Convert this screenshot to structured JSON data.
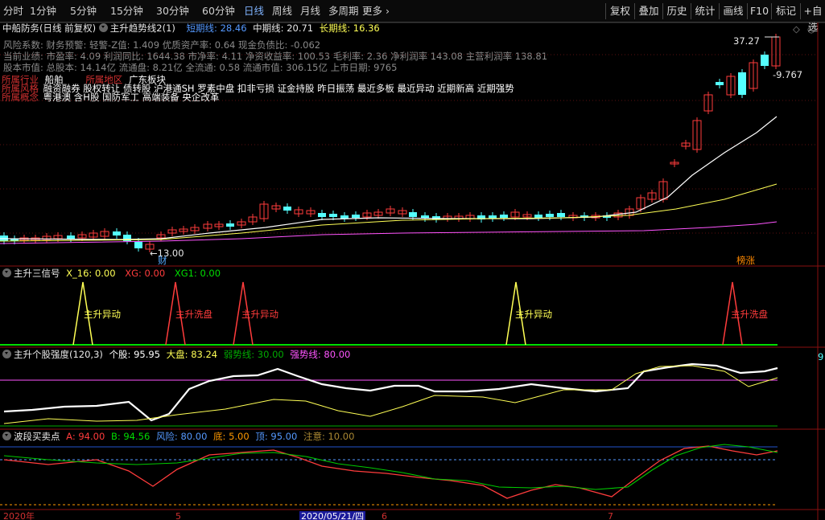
{
  "toolbar": {
    "periods": [
      "分时",
      "1分钟",
      "5分钟",
      "15分钟",
      "30分钟",
      "60分钟",
      "日线",
      "周线",
      "月线",
      "多周期",
      "更多"
    ],
    "active_period": "日线",
    "right_buttons": [
      "复权",
      "叠加",
      "历史",
      "统计",
      "画线",
      "F10",
      "标记",
      "+自选"
    ]
  },
  "main_panel": {
    "stock": "中船防务(日线 前复权)",
    "indicator": "主升趋势线2(1)",
    "short_line": "短期线: 28.46",
    "mid_line": "中期线: 20.71",
    "long_line": "长期线: 16.36",
    "info_lines": [
      "风险系数: 财务预警: 轻警-Z值: 1.409 优质资产率: 0.64 现金负债比: -0.062",
      "当前业绩: 市盈率: 4.09 利润同比: 1644.38 市净率: 4.11 净资收益率: 100.53 毛利率: 2.36 净利润率 143.08 主营利润率 138.81",
      "股本市值: 总股本: 14.14亿 流通盘: 8.21亿 全流通: 0.58 流通市值: 306.15亿 上市日期: 9765"
    ],
    "industry_label": "所属行业",
    "industry_value": "船舶",
    "region_label": "所属地区",
    "region_value": "广东板块",
    "style_label": "所属风格",
    "style_value": "融资融券 股权转让 债转股 沪港通SH 罗素中盘 扣非亏损 证金持股 昨日振荡 最近多板 最近异动 近期新高 近期强势",
    "concept_label": "所属概念",
    "concept_value": "粤港澳 含H股 国防军工 高端装备 央企改革",
    "high_label": "37.27",
    "low_label": "13.00",
    "pct_label": "-9.767",
    "fin_badge": "财",
    "rank_badge": "榜涨"
  },
  "signal_panel": {
    "title": "主升三信号",
    "x16": "X_16: 0.00",
    "xg": "XG: 0.00",
    "xg1": "XG1: 0.00",
    "signals": [
      {
        "text": "主升异动",
        "color": "yellow"
      },
      {
        "text": "主升洗盘",
        "color": "red"
      },
      {
        "text": "主升异动",
        "color": "red"
      },
      {
        "text": "主升异动",
        "color": "yellow"
      },
      {
        "text": "主升洗盘",
        "color": "red"
      }
    ]
  },
  "strength_panel": {
    "title": "主升个股强度(120,3)",
    "stock": "个股: 95.95",
    "market": "大盘: 83.24",
    "weak": "弱势线: 30.00",
    "strong": "强势线: 80.00",
    "edge_value": "9"
  },
  "wave_panel": {
    "title": "波段买卖点",
    "a": "A: 94.00",
    "b": "B: 94.56",
    "risk": "风险: 80.00",
    "bottom": "底: 5.00",
    "top": "顶: 95.00",
    "attention": "注意: 10.00"
  },
  "time_axis": {
    "labels": [
      "2020年",
      "5",
      "2020/05/21/四",
      "6",
      "7"
    ]
  },
  "colors": {
    "up": "#ff3c3c",
    "down": "#54ffff",
    "yellow": "#ffff55",
    "magenta": "#ff55ff",
    "green": "#00dd00",
    "orange": "#ff9900"
  }
}
